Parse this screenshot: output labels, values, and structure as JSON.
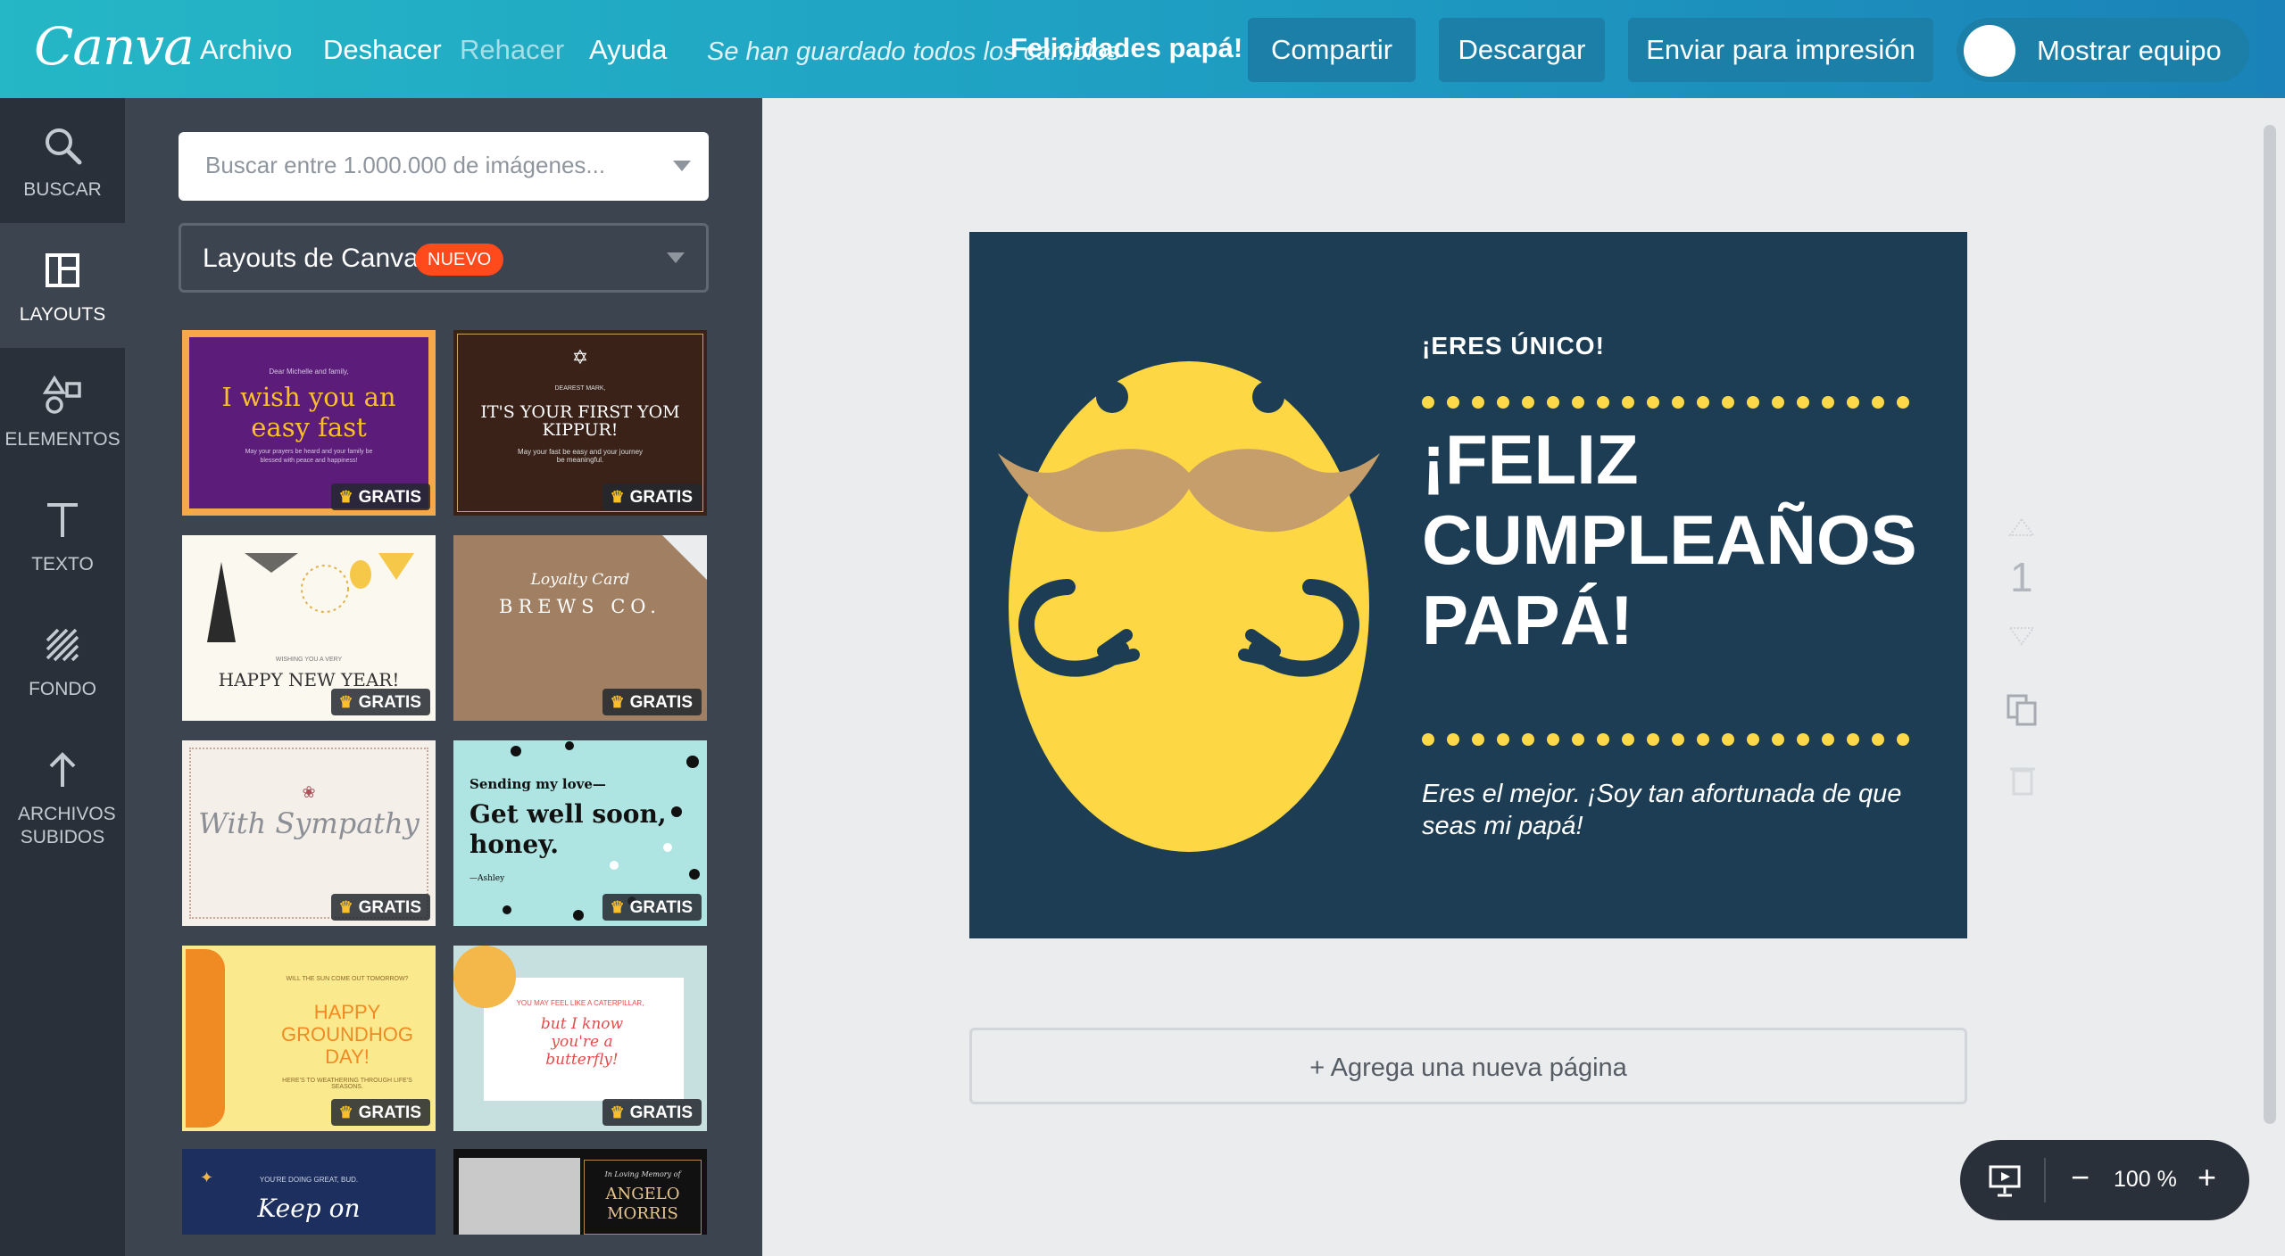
{
  "app": {
    "logo": "Canva"
  },
  "menu": {
    "file": "Archivo",
    "undo": "Deshacer",
    "redo": "Rehacer",
    "help": "Ayuda",
    "saved_status": "Se han guardado todos los cambios",
    "document_title": "Felicidades papá!"
  },
  "toolbar": {
    "share": "Compartir",
    "download": "Descargar",
    "print": "Enviar para impresión",
    "team": "Mostrar equipo"
  },
  "rail": [
    {
      "label": "BUSCAR",
      "icon": "search-icon"
    },
    {
      "label": "LAYOUTS",
      "icon": "layouts-icon"
    },
    {
      "label": "ELEMENTOS",
      "icon": "elements-icon"
    },
    {
      "label": "TEXTO",
      "icon": "text-icon"
    },
    {
      "label": "FONDO",
      "icon": "background-icon"
    },
    {
      "label": "ARCHIVOS SUBIDOS",
      "icon": "upload-icon"
    }
  ],
  "panel": {
    "search_placeholder": "Buscar entre 1.000.000 de imágenes...",
    "layouts_label": "Layouts de Canva",
    "new_badge": "NUEVO",
    "free_badge": "GRATIS",
    "thumbnails": [
      {
        "title": "I wish you an easy fast",
        "small": "Dear Michelle and family,",
        "footer": "May your prayers be heard and your family be blessed with peace and happiness!"
      },
      {
        "title": "IT'S YOUR FIRST YOM KIPPUR!",
        "small": "DEAREST MARK,",
        "footer": "May your fast be easy and your journey be meaningful."
      },
      {
        "title": "HAPPY NEW YEAR!",
        "small": "WISHING YOU A VERY"
      },
      {
        "title": "BREWS CO.",
        "small": "Loyalty Card"
      },
      {
        "title": "With Sympathy"
      },
      {
        "title": "Get well soon, honey.",
        "small": "Sending my love—",
        "footer": "—Ashley"
      },
      {
        "title": "HAPPY GROUNDHOG DAY!",
        "small": "WILL THE SUN COME OUT TOMORROW?",
        "footer": "HERE'S TO WEATHERING THROUGH LIFE'S SEASONS."
      },
      {
        "title": "but I know you're a butterfly!",
        "small": "YOU MAY FEEL LIKE A CATERPILLAR,"
      },
      {
        "title": "Keep on",
        "small": "YOU'RE DOING GREAT, BUD."
      },
      {
        "title": "ANGELO MORRIS",
        "small": "In Loving Memory of"
      }
    ]
  },
  "card": {
    "eyebrow": "¡ERES ÚNICO!",
    "title": "¡FELIZ CUMPLEAÑOS PAPÁ!",
    "body": "Eres el mejor. ¡Soy tan afortunada de que seas mi papá!",
    "background": "#1c3d54",
    "accent": "#fdd94a"
  },
  "page_number": "1",
  "add_page": "+ Agrega una nueva página",
  "zoom": {
    "value": "100 %",
    "minus": "−",
    "plus": "+"
  }
}
